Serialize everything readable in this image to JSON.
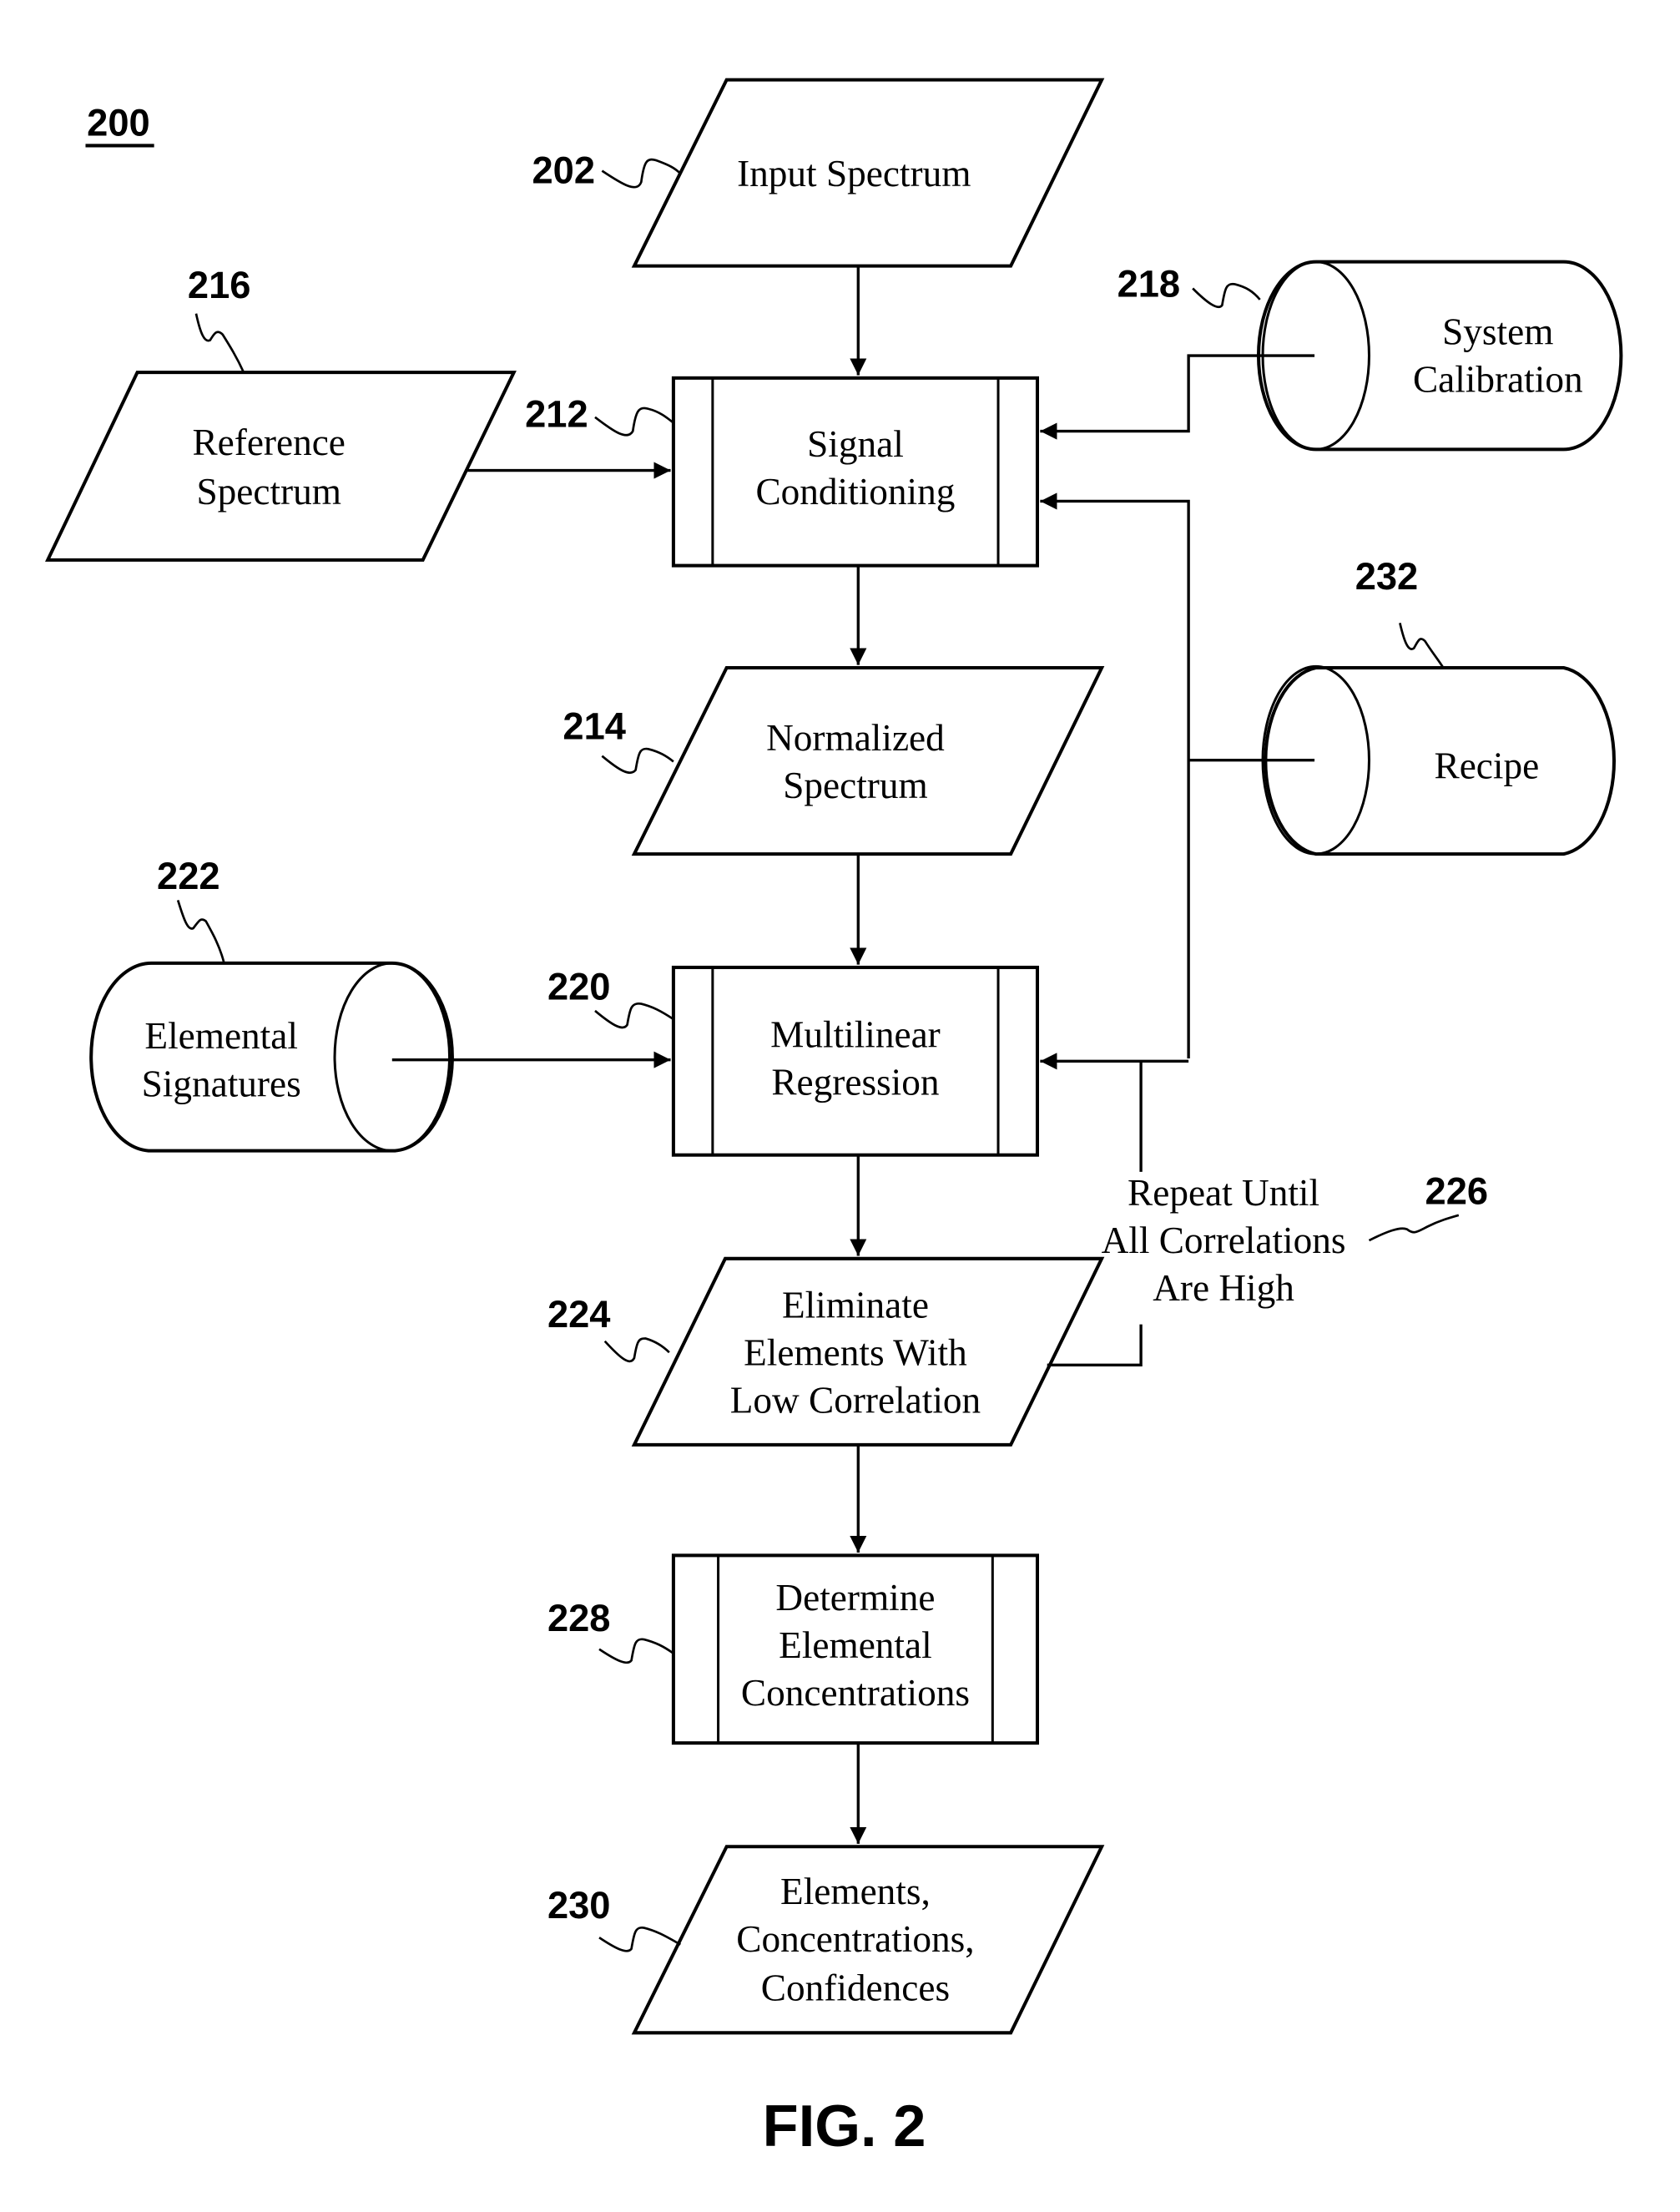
{
  "figure": {
    "number_label": "200",
    "caption": "FIG. 2"
  },
  "nodes": {
    "input_spectrum": {
      "ref": "202",
      "shape": "parallelogram",
      "lines": [
        "Input Spectrum"
      ]
    },
    "signal_conditioning": {
      "ref": "212",
      "shape": "predefined-process",
      "lines": [
        "Signal",
        "Conditioning"
      ]
    },
    "reference_spectrum": {
      "ref": "216",
      "shape": "parallelogram",
      "lines": [
        "Reference",
        "Spectrum"
      ]
    },
    "system_calibration": {
      "ref": "218",
      "shape": "database",
      "lines": [
        "System",
        "Calibration"
      ]
    },
    "normalized_spectrum": {
      "ref": "214",
      "shape": "parallelogram",
      "lines": [
        "Normalized",
        "Spectrum"
      ]
    },
    "recipe": {
      "ref": "232",
      "shape": "database",
      "lines": [
        "Recipe"
      ]
    },
    "elemental_signatures": {
      "ref": "222",
      "shape": "database",
      "lines": [
        "Elemental",
        "Signatures"
      ]
    },
    "multilinear_regression": {
      "ref": "220",
      "shape": "predefined-process",
      "lines": [
        "Multilinear",
        "Regression"
      ]
    },
    "eliminate_elements": {
      "ref": "224",
      "shape": "parallelogram",
      "lines": [
        "Eliminate",
        "Elements With",
        "Low Correlation"
      ]
    },
    "loop_note": {
      "ref": "226",
      "lines": [
        "Repeat Until",
        "All Correlations",
        "Are High"
      ]
    },
    "determine_concentrations": {
      "ref": "228",
      "shape": "predefined-process",
      "lines": [
        "Determine",
        "Elemental",
        "Concentrations"
      ]
    },
    "output": {
      "ref": "230",
      "shape": "parallelogram",
      "lines": [
        "Elements,",
        "Concentrations,",
        "Confidences"
      ]
    }
  },
  "edges": [
    {
      "from": "input_spectrum",
      "to": "signal_conditioning"
    },
    {
      "from": "reference_spectrum",
      "to": "signal_conditioning"
    },
    {
      "from": "system_calibration",
      "to": "signal_conditioning"
    },
    {
      "from": "recipe",
      "to": "signal_conditioning"
    },
    {
      "from": "recipe",
      "to": "multilinear_regression"
    },
    {
      "from": "signal_conditioning",
      "to": "normalized_spectrum"
    },
    {
      "from": "normalized_spectrum",
      "to": "multilinear_regression"
    },
    {
      "from": "elemental_signatures",
      "to": "multilinear_regression"
    },
    {
      "from": "multilinear_regression",
      "to": "eliminate_elements"
    },
    {
      "from": "eliminate_elements",
      "to": "multilinear_regression",
      "label_ref": "226"
    },
    {
      "from": "eliminate_elements",
      "to": "determine_concentrations"
    },
    {
      "from": "determine_concentrations",
      "to": "output"
    }
  ]
}
